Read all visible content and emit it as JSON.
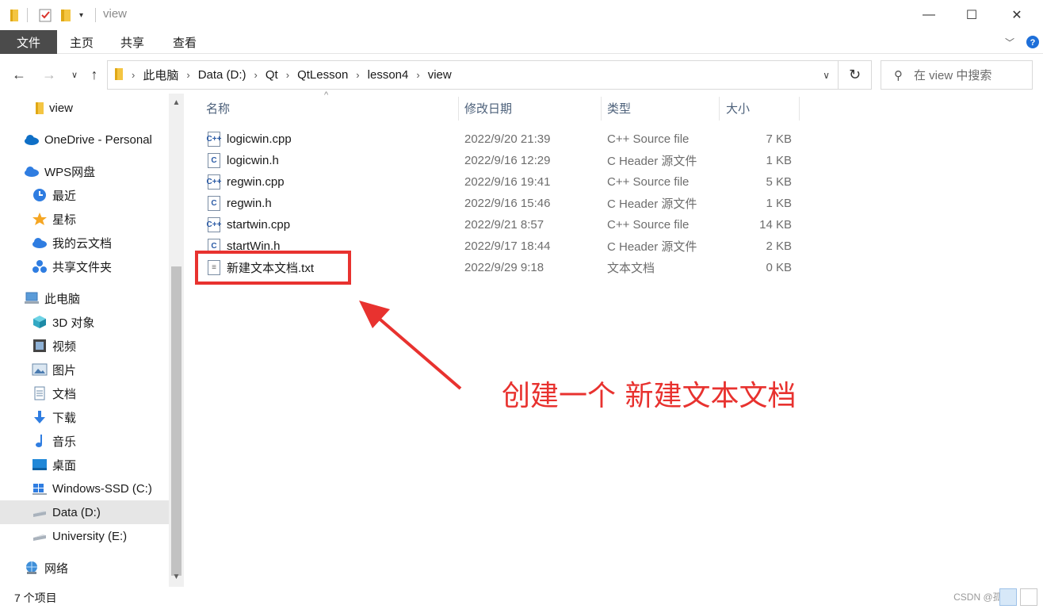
{
  "window": {
    "title": "view",
    "minimize": "—",
    "maximize": "☐",
    "close": "✕"
  },
  "ribbon": {
    "tabs": [
      "文件",
      "主页",
      "共享",
      "查看"
    ],
    "expand_icon": "chevron-down-icon",
    "help_icon": "help-icon"
  },
  "address": {
    "crumbs": [
      "此电脑",
      "Data (D:)",
      "Qt",
      "QtLesson",
      "lesson4",
      "view"
    ],
    "search_placeholder": "在 view 中搜索"
  },
  "nav": {
    "items": [
      {
        "label": "view",
        "icon": "folder-icon"
      },
      {
        "label": "OneDrive - Personal",
        "icon": "cloud-icon"
      },
      {
        "label": "WPS网盘",
        "icon": "cloud-icon"
      },
      {
        "label": "最近",
        "icon": "clock-icon"
      },
      {
        "label": "星标",
        "icon": "star-icon"
      },
      {
        "label": "我的云文档",
        "icon": "cloud-icon"
      },
      {
        "label": "共享文件夹",
        "icon": "share-icon"
      },
      {
        "label": "此电脑",
        "icon": "computer-icon"
      },
      {
        "label": "3D 对象",
        "icon": "cube-icon"
      },
      {
        "label": "视频",
        "icon": "video-icon"
      },
      {
        "label": "图片",
        "icon": "picture-icon"
      },
      {
        "label": "文档",
        "icon": "document-icon"
      },
      {
        "label": "下载",
        "icon": "download-icon"
      },
      {
        "label": "音乐",
        "icon": "music-icon"
      },
      {
        "label": "桌面",
        "icon": "desktop-icon"
      },
      {
        "label": "Windows-SSD (C:)",
        "icon": "drive-icon"
      },
      {
        "label": "Data (D:)",
        "icon": "drive-icon",
        "selected": true
      },
      {
        "label": "University (E:)",
        "icon": "drive-icon"
      },
      {
        "label": "网络",
        "icon": "network-icon"
      }
    ]
  },
  "columns": [
    "名称",
    "修改日期",
    "类型",
    "大小"
  ],
  "files": [
    {
      "name": "logicwin.cpp",
      "date": "2022/9/20 21:39",
      "type": "C++ Source file",
      "size": "7 KB",
      "icon": "cpp-file-icon",
      "glyph": "C++"
    },
    {
      "name": "logicwin.h",
      "date": "2022/9/16 12:29",
      "type": "C Header 源文件",
      "size": "1 KB",
      "icon": "header-file-icon",
      "glyph": "C"
    },
    {
      "name": "regwin.cpp",
      "date": "2022/9/16 19:41",
      "type": "C++ Source file",
      "size": "5 KB",
      "icon": "cpp-file-icon",
      "glyph": "C++"
    },
    {
      "name": "regwin.h",
      "date": "2022/9/16 15:46",
      "type": "C Header 源文件",
      "size": "1 KB",
      "icon": "header-file-icon",
      "glyph": "C"
    },
    {
      "name": "startwin.cpp",
      "date": "2022/9/21 8:57",
      "type": "C++ Source file",
      "size": "14 KB",
      "icon": "cpp-file-icon",
      "glyph": "C++"
    },
    {
      "name": "startWin.h",
      "date": "2022/9/17 18:44",
      "type": "C Header 源文件",
      "size": "2 KB",
      "icon": "header-file-icon",
      "glyph": "C"
    },
    {
      "name": "新建文本文档.txt",
      "date": "2022/9/29 9:18",
      "type": "文本文档",
      "size": "0 KB",
      "icon": "text-file-icon",
      "glyph": "≡"
    }
  ],
  "annotation": {
    "text": "创建一个 新建文本文档",
    "color": "#e8322f"
  },
  "status": {
    "count": "7 个项目",
    "watermark": "CSDN @孤4-3"
  }
}
